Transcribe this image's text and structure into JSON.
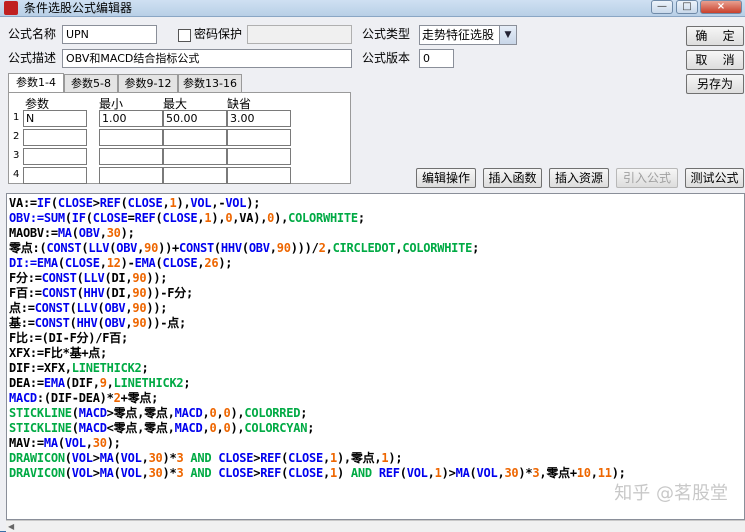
{
  "window": {
    "title": "条件选股公式编辑器",
    "min_label": "—",
    "max_label": "□",
    "close_label": "×"
  },
  "form": {
    "name_label": "公式名称",
    "name_value": "UPN",
    "password_label": "密码保护",
    "type_label": "公式类型",
    "type_value": "走势特征选股",
    "desc_label": "公式描述",
    "desc_value": "OBV和MACD结合指标公式",
    "version_label": "公式版本",
    "version_value": "0"
  },
  "side_buttons": {
    "ok": "确    定",
    "cancel": "取    消",
    "saveas": "另存为"
  },
  "tabs": [
    "参数1-4",
    "参数5-8",
    "参数9-12",
    "参数13-16"
  ],
  "params": {
    "headers": [
      "参数",
      "最小",
      "最大",
      "缺省"
    ],
    "rows": [
      {
        "num": "1",
        "name": "N",
        "min": "1.00",
        "max": "50.00",
        "default": "3.00"
      },
      {
        "num": "2",
        "name": "",
        "min": "",
        "max": "",
        "default": ""
      },
      {
        "num": "3",
        "name": "",
        "min": "",
        "max": "",
        "default": ""
      },
      {
        "num": "4",
        "name": "",
        "min": "",
        "max": "",
        "default": ""
      }
    ]
  },
  "action_buttons": {
    "edit": "编辑操作",
    "insert_func": "插入函数",
    "insert_res": "插入资源",
    "import": "引入公式",
    "test": "测试公式"
  },
  "watermark": "知乎 @茗股堂",
  "colors": {
    "keyword": "#0000ee",
    "number": "#ee6600",
    "plain": "#000000",
    "style": "#00aa44",
    "navy": "#000080"
  },
  "code_lines": [
    [
      [
        "VA:=",
        "k"
      ],
      [
        "IF",
        "b"
      ],
      [
        "(",
        "k"
      ],
      [
        "CLOSE",
        "b"
      ],
      [
        ">",
        "k"
      ],
      [
        "REF",
        "b"
      ],
      [
        "(",
        "k"
      ],
      [
        "CLOSE",
        "b"
      ],
      [
        ",",
        "k"
      ],
      [
        "1",
        "n"
      ],
      [
        "),",
        "k"
      ],
      [
        "VOL",
        "b"
      ],
      [
        ",-",
        "k"
      ],
      [
        "VOL",
        "b"
      ],
      [
        ");",
        "k"
      ]
    ],
    [
      [
        "OBV:=",
        "b"
      ],
      [
        "SUM",
        "b"
      ],
      [
        "(",
        "k"
      ],
      [
        "IF",
        "b"
      ],
      [
        "(",
        "k"
      ],
      [
        "CLOSE",
        "b"
      ],
      [
        "=",
        "k"
      ],
      [
        "REF",
        "b"
      ],
      [
        "(",
        "k"
      ],
      [
        "CLOSE",
        "b"
      ],
      [
        ",",
        "k"
      ],
      [
        "1",
        "n"
      ],
      [
        "),",
        "k"
      ],
      [
        "0",
        "n"
      ],
      [
        ",VA),",
        "k"
      ],
      [
        "0",
        "n"
      ],
      [
        "),",
        "k"
      ],
      [
        "COLORWHITE",
        "g"
      ],
      [
        ";",
        "k"
      ]
    ],
    [
      [
        "MAOBV:=",
        "k"
      ],
      [
        "MA",
        "b"
      ],
      [
        "(",
        "k"
      ],
      [
        "OBV",
        "b"
      ],
      [
        ",",
        "k"
      ],
      [
        "30",
        "n"
      ],
      [
        ");",
        "k"
      ]
    ],
    [
      [
        "零点:(",
        "k"
      ],
      [
        "CONST",
        "b"
      ],
      [
        "(",
        "k"
      ],
      [
        "LLV",
        "b"
      ],
      [
        "(",
        "k"
      ],
      [
        "OBV",
        "b"
      ],
      [
        ",",
        "k"
      ],
      [
        "90",
        "n"
      ],
      [
        "))+",
        "k"
      ],
      [
        "CONST",
        "b"
      ],
      [
        "(",
        "k"
      ],
      [
        "HHV",
        "b"
      ],
      [
        "(",
        "k"
      ],
      [
        "OBV",
        "b"
      ],
      [
        ",",
        "k"
      ],
      [
        "90",
        "n"
      ],
      [
        ")))/",
        "k"
      ],
      [
        "2",
        "n"
      ],
      [
        ",",
        "k"
      ],
      [
        "CIRCLEDOT",
        "g"
      ],
      [
        ",",
        "k"
      ],
      [
        "COLORWHITE",
        "g"
      ],
      [
        ";",
        "k"
      ]
    ],
    [
      [
        "DI:=",
        "b"
      ],
      [
        "EMA",
        "b"
      ],
      [
        "(",
        "k"
      ],
      [
        "CLOSE",
        "b"
      ],
      [
        ",",
        "k"
      ],
      [
        "12",
        "n"
      ],
      [
        ")-",
        "k"
      ],
      [
        "EMA",
        "b"
      ],
      [
        "(",
        "k"
      ],
      [
        "CLOSE",
        "b"
      ],
      [
        ",",
        "k"
      ],
      [
        "26",
        "n"
      ],
      [
        ");",
        "k"
      ]
    ],
    [
      [
        "F分:=",
        "k"
      ],
      [
        "CONST",
        "b"
      ],
      [
        "(",
        "k"
      ],
      [
        "LLV",
        "b"
      ],
      [
        "(DI,",
        "k"
      ],
      [
        "90",
        "n"
      ],
      [
        "));",
        "k"
      ]
    ],
    [
      [
        "F百:=",
        "k"
      ],
      [
        "CONST",
        "b"
      ],
      [
        "(",
        "k"
      ],
      [
        "HHV",
        "b"
      ],
      [
        "(DI,",
        "k"
      ],
      [
        "90",
        "n"
      ],
      [
        "))-F分;",
        "k"
      ]
    ],
    [
      [
        "点:=",
        "k"
      ],
      [
        "CONST",
        "b"
      ],
      [
        "(",
        "k"
      ],
      [
        "LLV",
        "b"
      ],
      [
        "(",
        "k"
      ],
      [
        "OBV",
        "b"
      ],
      [
        ",",
        "k"
      ],
      [
        "90",
        "n"
      ],
      [
        "));",
        "k"
      ]
    ],
    [
      [
        "基:=",
        "k"
      ],
      [
        "CONST",
        "b"
      ],
      [
        "(",
        "k"
      ],
      [
        "HHV",
        "b"
      ],
      [
        "(",
        "k"
      ],
      [
        "OBV",
        "b"
      ],
      [
        ",",
        "k"
      ],
      [
        "90",
        "n"
      ],
      [
        "))-点;",
        "k"
      ]
    ],
    [
      [
        "F比:=(DI-F分)/F百;",
        "k"
      ]
    ],
    [
      [
        "XFX:=F比*基+点;",
        "k"
      ]
    ],
    [
      [
        "DIF:=XFX,",
        "k"
      ],
      [
        "LINETHICK2",
        "g"
      ],
      [
        ";",
        "k"
      ]
    ],
    [
      [
        "DEA:=",
        "k"
      ],
      [
        "EMA",
        "b"
      ],
      [
        "(DIF,",
        "k"
      ],
      [
        "9",
        "n"
      ],
      [
        ",",
        "k"
      ],
      [
        "LINETHICK2",
        "g"
      ],
      [
        ";",
        "k"
      ]
    ],
    [
      [
        "MACD",
        "b"
      ],
      [
        ":(DIF-DEA)*",
        "k"
      ],
      [
        "2",
        "n"
      ],
      [
        "+零点;",
        "k"
      ]
    ],
    [
      [
        "STICKLINE",
        "g"
      ],
      [
        "(",
        "k"
      ],
      [
        "MACD",
        "b"
      ],
      [
        ">零点,零点,",
        "k"
      ],
      [
        "MACD",
        "b"
      ],
      [
        ",",
        "k"
      ],
      [
        "0",
        "n"
      ],
      [
        ",",
        "k"
      ],
      [
        "0",
        "n"
      ],
      [
        "),",
        "k"
      ],
      [
        "COLORRED",
        "g"
      ],
      [
        ";",
        "k"
      ]
    ],
    [
      [
        "STICKLINE",
        "g"
      ],
      [
        "(",
        "k"
      ],
      [
        "MACD",
        "b"
      ],
      [
        "<零点,零点,",
        "k"
      ],
      [
        "MACD",
        "b"
      ],
      [
        ",",
        "k"
      ],
      [
        "0",
        "n"
      ],
      [
        ",",
        "k"
      ],
      [
        "0",
        "n"
      ],
      [
        "),",
        "k"
      ],
      [
        "COLORCYAN",
        "g"
      ],
      [
        ";",
        "k"
      ]
    ],
    [
      [
        "MAV:=",
        "k"
      ],
      [
        "MA",
        "b"
      ],
      [
        "(",
        "k"
      ],
      [
        "VOL",
        "b"
      ],
      [
        ",",
        "k"
      ],
      [
        "30",
        "n"
      ],
      [
        ");",
        "k"
      ]
    ],
    [
      [
        "DRAWICON",
        "g"
      ],
      [
        "(",
        "k"
      ],
      [
        "VOL",
        "b"
      ],
      [
        ">",
        "k"
      ],
      [
        "MA",
        "b"
      ],
      [
        "(",
        "k"
      ],
      [
        "VOL",
        "b"
      ],
      [
        ",",
        "k"
      ],
      [
        "30",
        "n"
      ],
      [
        ")*",
        "k"
      ],
      [
        "3",
        "n"
      ],
      [
        " AND ",
        "g"
      ],
      [
        "CLOSE",
        "b"
      ],
      [
        ">",
        "k"
      ],
      [
        "REF",
        "b"
      ],
      [
        "(",
        "k"
      ],
      [
        "CLOSE",
        "b"
      ],
      [
        ",",
        "k"
      ],
      [
        "1",
        "n"
      ],
      [
        "),零点,",
        "k"
      ],
      [
        "1",
        "n"
      ],
      [
        ");",
        "k"
      ]
    ],
    [
      [
        "DRAVICON",
        "g"
      ],
      [
        "(",
        "k"
      ],
      [
        "VOL",
        "b"
      ],
      [
        ">",
        "k"
      ],
      [
        "MA",
        "b"
      ],
      [
        "(",
        "k"
      ],
      [
        "VOL",
        "b"
      ],
      [
        ",",
        "k"
      ],
      [
        "30",
        "n"
      ],
      [
        ")*",
        "k"
      ],
      [
        "3",
        "n"
      ],
      [
        " AND ",
        "g"
      ],
      [
        "CLOSE",
        "b"
      ],
      [
        ">",
        "k"
      ],
      [
        "REF",
        "b"
      ],
      [
        "(",
        "k"
      ],
      [
        "CLOSE",
        "b"
      ],
      [
        ",",
        "k"
      ],
      [
        "1",
        "n"
      ],
      [
        ")",
        "k"
      ],
      [
        " AND ",
        "g"
      ],
      [
        "REF",
        "b"
      ],
      [
        "(",
        "k"
      ],
      [
        "VOL",
        "b"
      ],
      [
        ",",
        "k"
      ],
      [
        "1",
        "n"
      ],
      [
        ")>",
        "k"
      ],
      [
        "MA",
        "b"
      ],
      [
        "(",
        "k"
      ],
      [
        "VOL",
        "b"
      ],
      [
        ",",
        "k"
      ],
      [
        "30",
        "n"
      ],
      [
        ")*",
        "k"
      ],
      [
        "3",
        "n"
      ],
      [
        ",零点+",
        "k"
      ],
      [
        "10",
        "n"
      ],
      [
        ",",
        "k"
      ],
      [
        "11",
        "n"
      ],
      [
        ");",
        "k"
      ]
    ]
  ]
}
